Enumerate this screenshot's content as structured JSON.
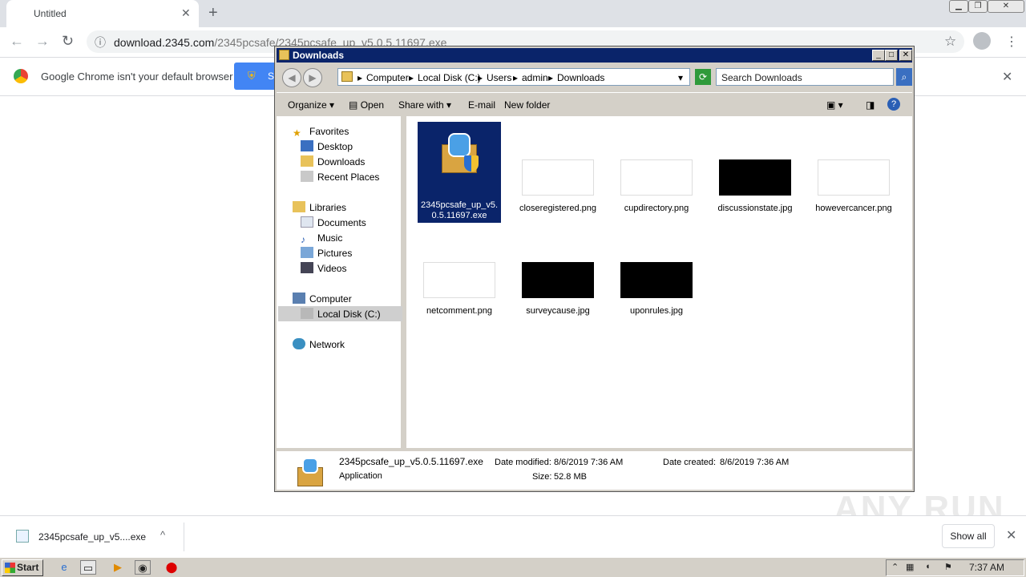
{
  "browser": {
    "tab_title": "Untitled",
    "url_host": "download.2345.com",
    "url_path": "/2345pcsafe/2345pcsafe_up_v5.0.5.11697.exe",
    "infobar_text": "Google Chrome isn't your default browser",
    "infobar_button_visible": "S",
    "download_item": "2345pcsafe_up_v5....exe",
    "show_all": "Show all"
  },
  "explorer": {
    "title": "Downloads",
    "breadcrumbs": [
      "Computer",
      "Local Disk (C:)",
      "Users",
      "admin",
      "Downloads"
    ],
    "search_placeholder": "Search Downloads",
    "commands": [
      "Organize",
      "Open",
      "Share with",
      "E-mail",
      "New folder"
    ],
    "nav": {
      "favorites": "Favorites",
      "desktop": "Desktop",
      "downloads": "Downloads",
      "recent": "Recent Places",
      "libraries": "Libraries",
      "documents": "Documents",
      "music": "Music",
      "pictures": "Pictures",
      "videos": "Videos",
      "computer": "Computer",
      "localdisk": "Local Disk (C:)",
      "network": "Network"
    },
    "files": [
      {
        "name": "2345pcsafe_up_v5.0.5.11697.exe"
      },
      {
        "name": "closeregistered.png"
      },
      {
        "name": "cupdirectory.png"
      },
      {
        "name": "discussionstate.jpg"
      },
      {
        "name": "howevercancer.png"
      },
      {
        "name": "netcomment.png"
      },
      {
        "name": "surveycause.jpg"
      },
      {
        "name": "uponrules.jpg"
      }
    ],
    "details": {
      "filename": "2345pcsafe_up_v5.0.5.11697.exe",
      "type": "Application",
      "date_modified_label": "Date modified:",
      "date_modified": "8/6/2019 7:36 AM",
      "date_created_label": "Date created:",
      "date_created": "8/6/2019 7:36 AM",
      "size_label": "Size:",
      "size": "52.8 MB"
    }
  },
  "taskbar": {
    "start": "Start",
    "clock": "7:37 AM"
  },
  "watermark": "ANY RUN"
}
